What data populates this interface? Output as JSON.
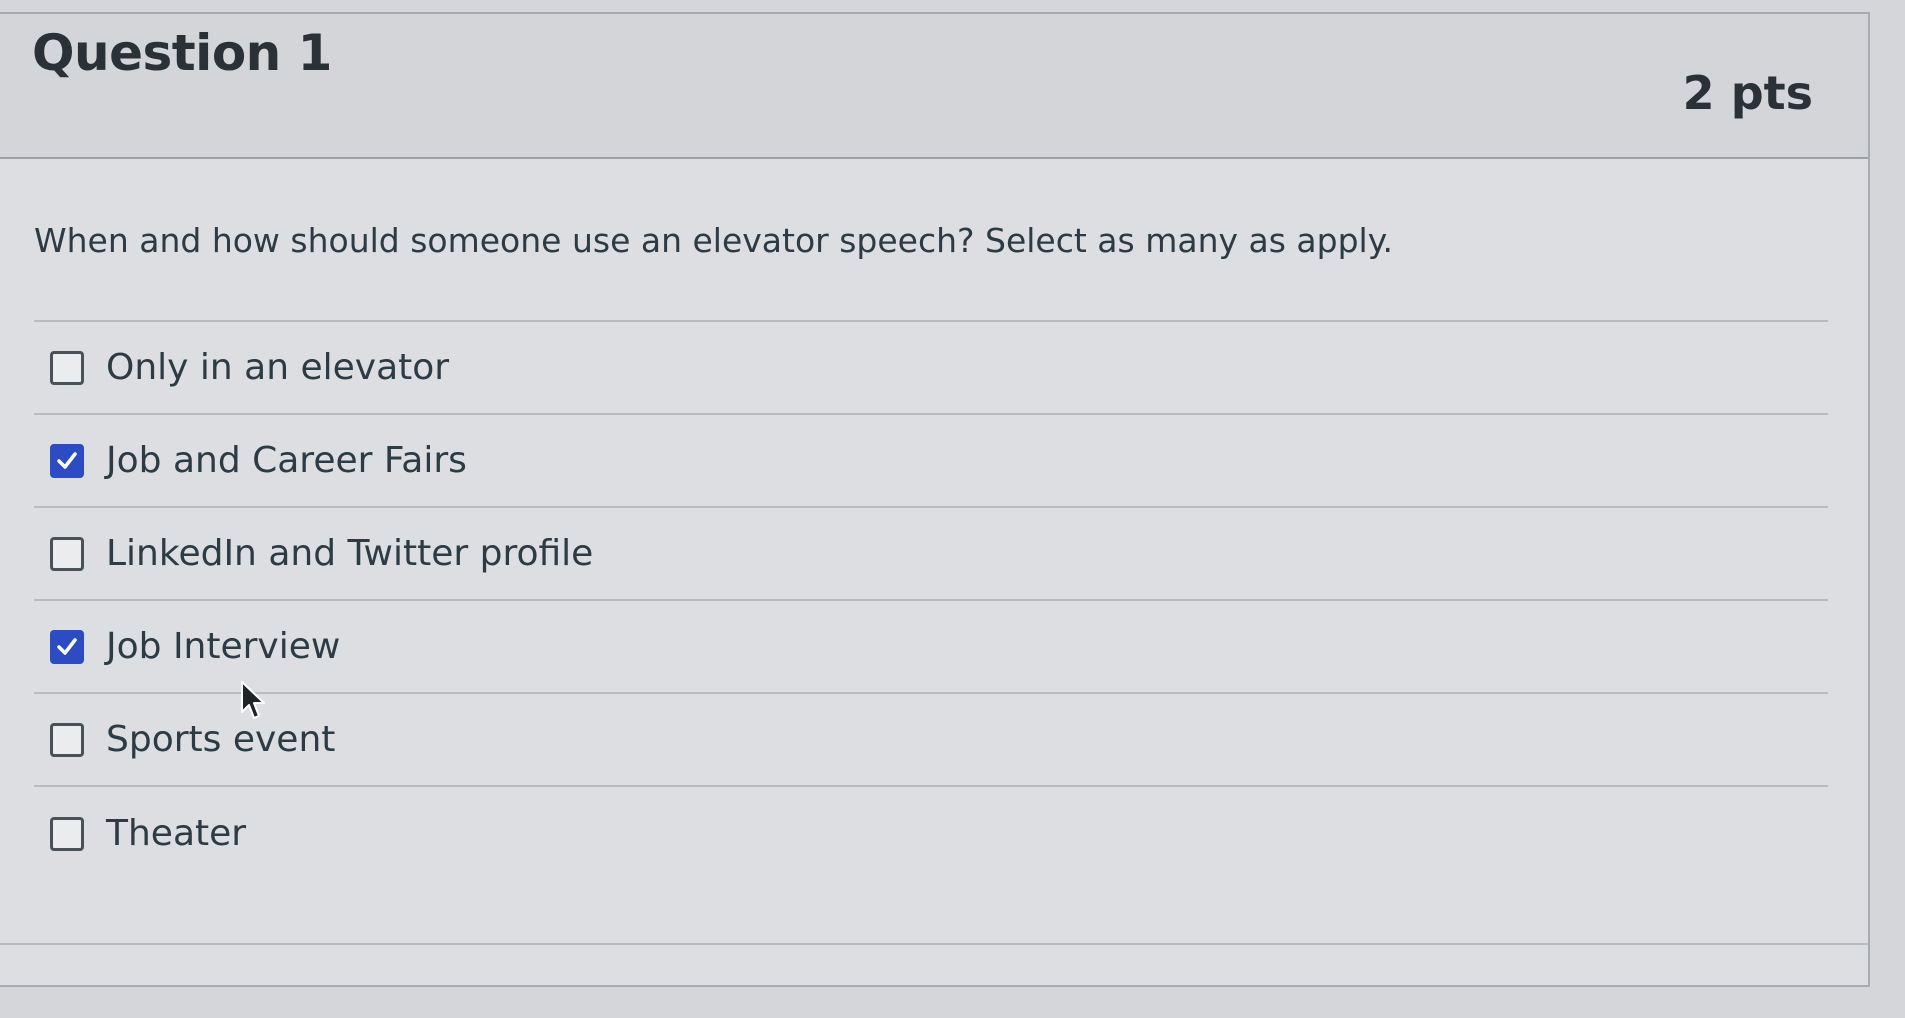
{
  "question": {
    "title": "Question 1",
    "points": "2 pts",
    "text": "When and how should someone use an elevator speech? Select as many as apply."
  },
  "answers": [
    {
      "label": "Only in an elevator",
      "checked": false
    },
    {
      "label": "Job and Career Fairs",
      "checked": true
    },
    {
      "label": "LinkedIn and Twitter profile",
      "checked": false
    },
    {
      "label": "Job Interview",
      "checked": true
    },
    {
      "label": "Sports event",
      "checked": false
    },
    {
      "label": "Theater",
      "checked": false
    }
  ],
  "colors": {
    "checkbox_checked": "#2b4cc4",
    "text": "#2d3b45"
  },
  "icons": {
    "checkmark": "checkmark-icon",
    "cursor": "mouse-pointer-icon"
  }
}
